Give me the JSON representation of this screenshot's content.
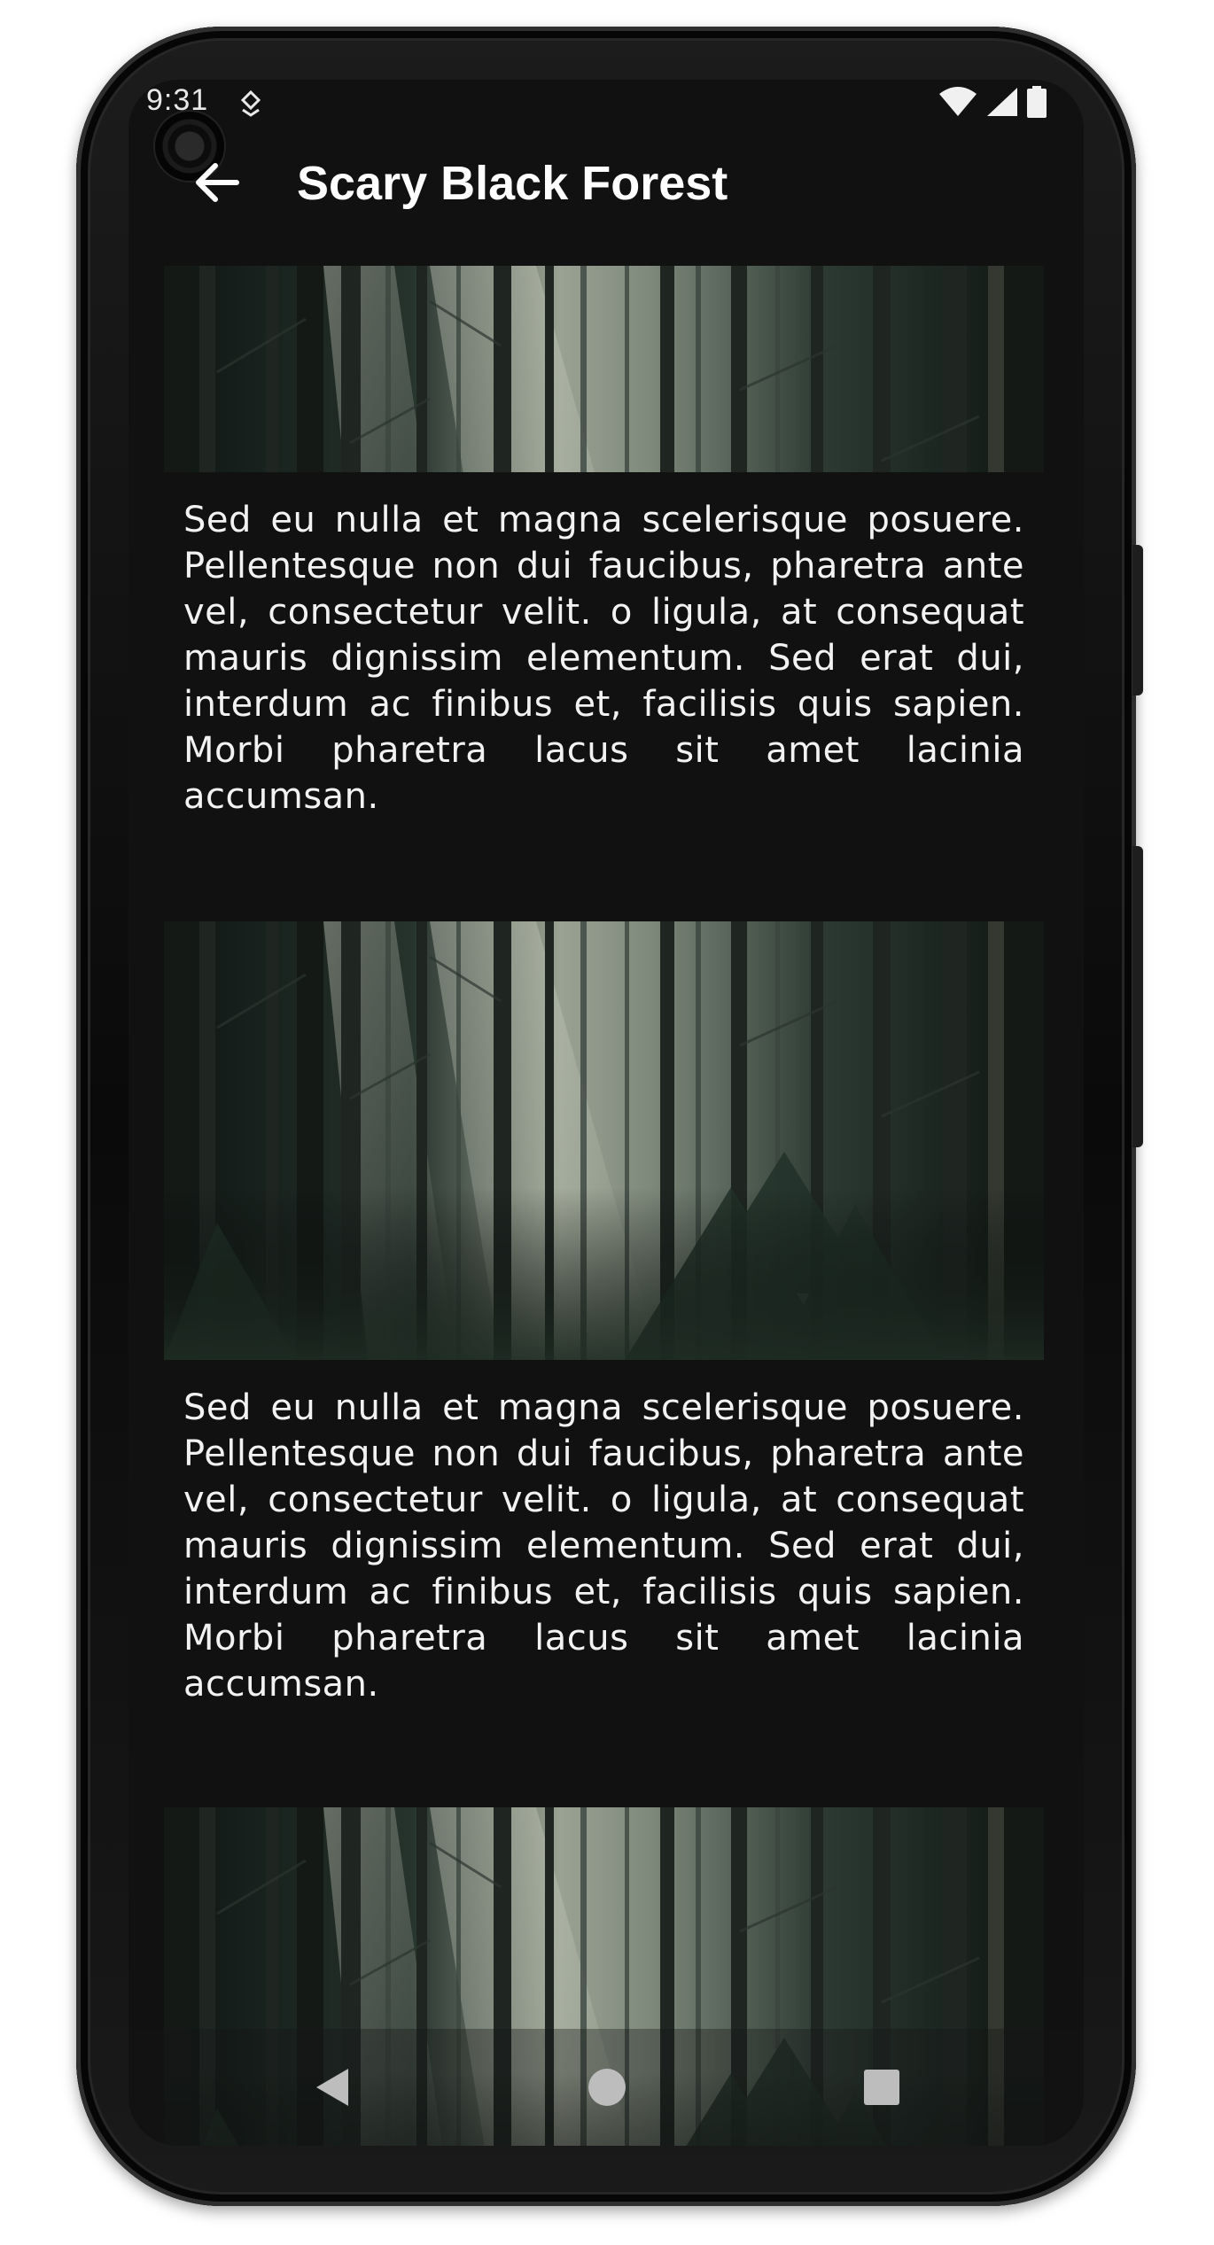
{
  "status_bar": {
    "time": "9:31",
    "icons": [
      "notification-icon",
      "wifi-icon",
      "signal-icon",
      "battery-icon"
    ]
  },
  "app_bar": {
    "title": "Scary Black Forest",
    "back_icon": "arrow-back-icon"
  },
  "cards": [
    {
      "image": "forest-image",
      "text": "Sed eu nulla et magna scelerisque posuere. Pellentesque non dui faucibus, pharetra ante vel, consectetur velit. o ligula, at consequat mauris dignissim elementum. Sed erat dui, interdum ac finibus et, facilisis quis sapien. Morbi pharetra lacus sit amet lacinia accumsan."
    },
    {
      "image": "forest-image",
      "text": "Sed eu nulla et magna scelerisque posuere. Pellentesque non dui faucibus, pharetra ante vel, consectetur velit. o ligula, at consequat mauris dignissim elementum. Sed erat dui, interdum ac finibus et, facilisis quis sapien. Morbi pharetra lacus sit amet lacinia accumsan."
    },
    {
      "image": "forest-image"
    }
  ],
  "nav_bar": {
    "icons": [
      "nav-back-icon",
      "nav-home-icon",
      "nav-recents-icon"
    ]
  },
  "colors": {
    "background": "#111111",
    "text": "#f2f2f2",
    "title": "#ffffff"
  }
}
